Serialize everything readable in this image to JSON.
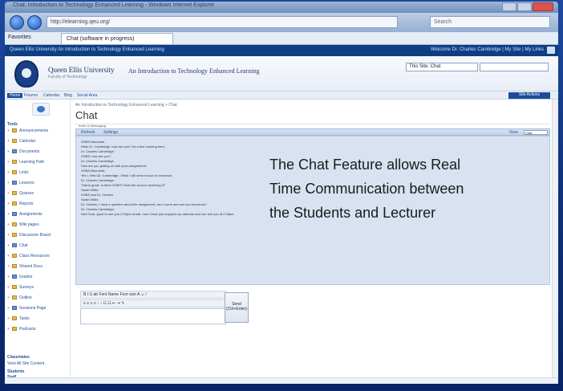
{
  "window": {
    "title": "Chat: Introduction to Technology Enhanced Learning - Windows Internet Explorer"
  },
  "browser": {
    "address": "http://elearning.qeu.org/",
    "search_placeholder": "Search",
    "favorites_label": "Favorites",
    "tab_label": "Chat (software in progress)"
  },
  "site": {
    "top_left": "Queen Ellis University   An Introduction to Technology Enhanced Learning",
    "top_right": "Welcome Dr. Charles Cambridge  |  My Site  |  My Links",
    "university": "Queen Ellis University",
    "university_sub": "Faculty of Technology",
    "course": "An Introduction to Technology Enhanced Learning",
    "scope_select": "This Site: Chat"
  },
  "menubar": {
    "items": [
      "Home",
      "Forums",
      "Calendar",
      "Blog",
      "Social Area"
    ],
    "actions": "Site Actions"
  },
  "leftnav": {
    "view_all": "View All Site Content",
    "head_tools": "Tools",
    "items": [
      "Announcements",
      "Calendar",
      "Documents",
      "Learning Path",
      "Links",
      "Lessons",
      "Quizzes",
      "Reports",
      "Assignments",
      "Wiki pages",
      "Discussion Board",
      "Chat",
      "Class Resources",
      "Shared Docs",
      "Grades",
      "Surveys",
      "Outline",
      "Sessions Page",
      "Tasks",
      "Podcasts"
    ],
    "head_people": "Classmates",
    "people": [
      "Students",
      "Staff",
      "Recordings",
      "Pages"
    ],
    "tail": [
      "Recent",
      "Site Pages",
      "Blog"
    ]
  },
  "page": {
    "breadcrumb": "An Introduction to Technology Enhanced Learning > Chat",
    "title": "Chat",
    "online_hint": "Invite & Messaging",
    "bar_refresh": "Refresh",
    "bar_settings": "Settings",
    "users_label": "View",
    "users_value": "Chat"
  },
  "chat_log": [
    "GSBS Bhurosah",
    "Hello Dr. Cambridge, how are you? It's a fine morning here.",
    "Dr. Charles Cambridge:",
    "GSBS, how are you?",
    "Dr. Charles Cambridge:",
    "How are you getting on with your assignment?",
    "GSBS Bhurosah:",
    "Yes I, hello Dr. Cambridge, I think I will send it soon to tomorrow.",
    "Dr. Charles Cambridge:",
    "That is great. Is there GSBS? Hold the send to receiving it?",
    "Sarah Willis:",
    "GSBS and Dr. Charles",
    "Sarah Willis:",
    "Dr. Charles, I have a question about the assignment, can I come and see you tomorrow?",
    "Dr. Charles Cambridge:",
    "Well Sure, good to see you 2:30pm at hall, now I have just enjoyed my calendar and can see you at 2:30pm"
  ],
  "composer": {
    "toolbar1": "B  I  U  ab   Font Name    Font size    A   ☺   ⁄",
    "toolbar2": "≡  ≡  ≡  ≡   ↕  ⁿ   ☷  ☷   ⇤  ⇥   ✎",
    "send_label": "Send (Ctrl+Enter)"
  },
  "overlay": {
    "line1": "The Chat Feature allows Real",
    "line2": "Time Communication between",
    "line3": "the Students and Lecturer"
  }
}
